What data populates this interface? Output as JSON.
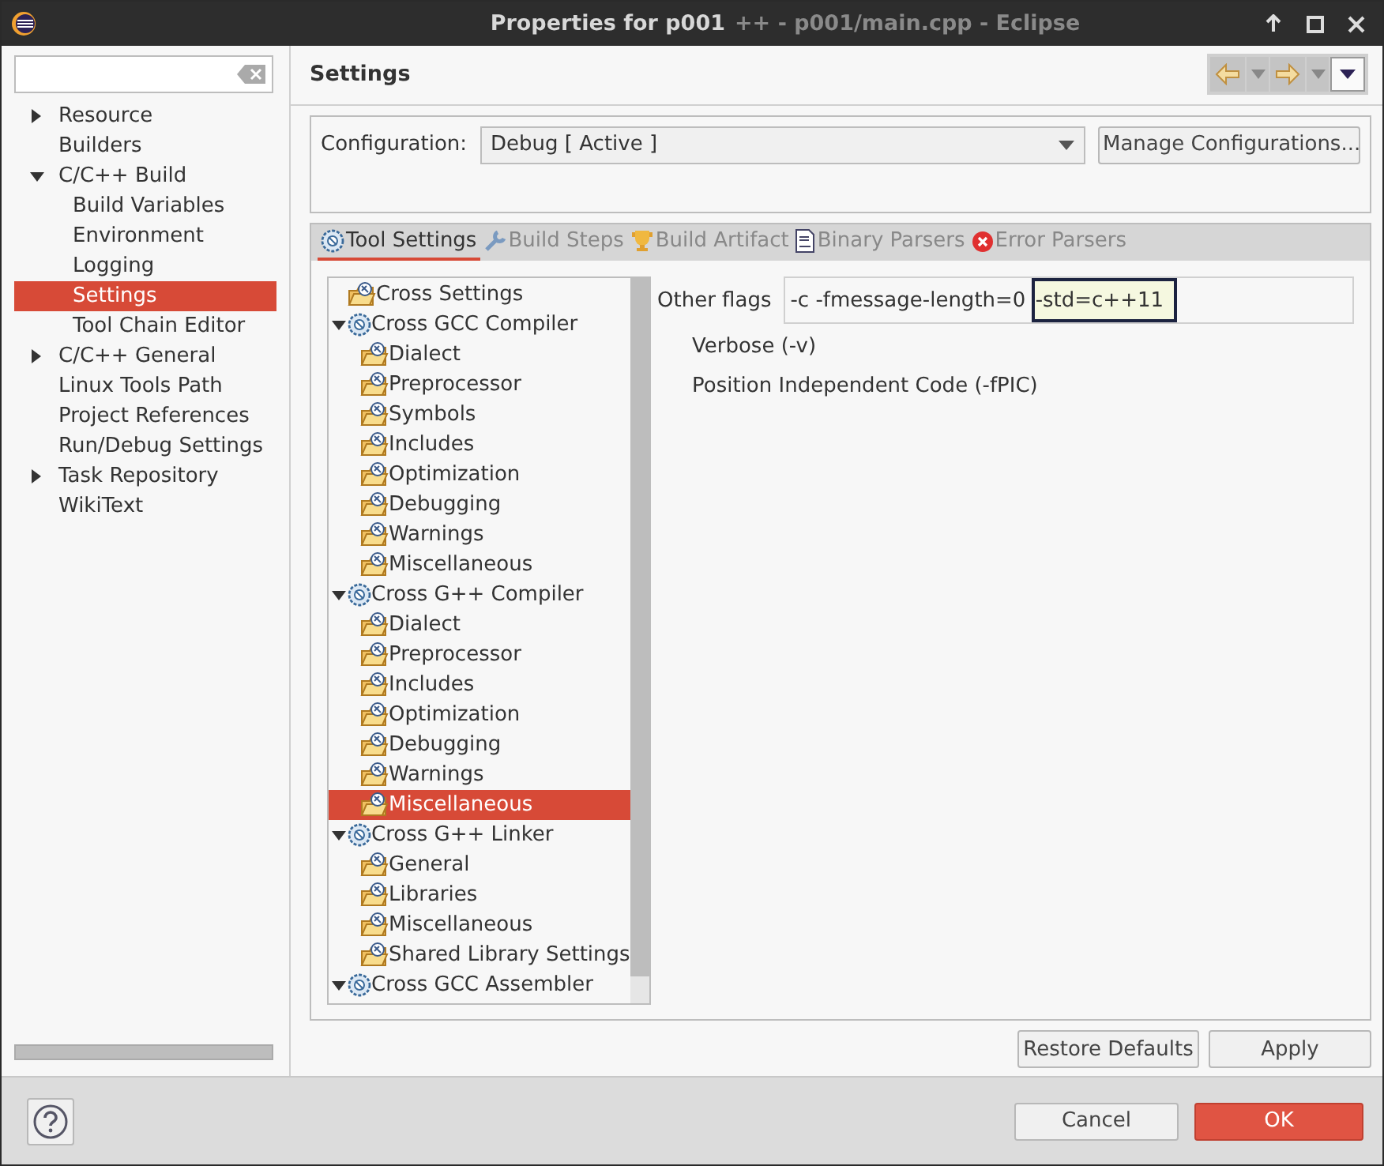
{
  "window": {
    "title": "Properties for p001",
    "behind_title": "++ - p001/main.cpp - Eclipse"
  },
  "sidebar": {
    "items": [
      {
        "label": "Resource",
        "expanded": false,
        "selected": false
      },
      {
        "label": "Builders",
        "selected": false
      },
      {
        "label": "C/C++ Build",
        "expanded": true,
        "selected": false,
        "children": [
          {
            "label": "Build Variables",
            "selected": false
          },
          {
            "label": "Environment",
            "selected": false
          },
          {
            "label": "Logging",
            "selected": false
          },
          {
            "label": "Settings",
            "selected": true
          },
          {
            "label": "Tool Chain Editor",
            "selected": false
          }
        ]
      },
      {
        "label": "C/C++ General",
        "expanded": false,
        "selected": false
      },
      {
        "label": "Linux Tools Path",
        "selected": false
      },
      {
        "label": "Project References",
        "selected": false
      },
      {
        "label": "Run/Debug Settings",
        "selected": false
      },
      {
        "label": "Task Repository",
        "expanded": false,
        "selected": false
      },
      {
        "label": "WikiText",
        "selected": false
      }
    ]
  },
  "page_title": "Settings",
  "configuration": {
    "label": "Configuration:",
    "value": "Debug  [ Active ]",
    "button": "Manage Configurations..."
  },
  "tabs": [
    {
      "label": "Tool Settings",
      "kind": "tool",
      "selected": true
    },
    {
      "label": "Build Steps",
      "kind": "steps",
      "selected": false
    },
    {
      "label": "Build Artifact",
      "kind": "artifact",
      "selected": false
    },
    {
      "label": "Binary Parsers",
      "kind": "binary",
      "selected": false
    },
    {
      "label": "Error Parsers",
      "kind": "error",
      "selected": false
    }
  ],
  "tool_tree": [
    {
      "label": "Cross Settings",
      "kind": "folder",
      "selected": false
    },
    {
      "label": "Cross GCC Compiler",
      "kind": "tool",
      "expanded": true,
      "selected": false,
      "children": [
        {
          "label": "Dialect",
          "kind": "folder",
          "selected": false
        },
        {
          "label": "Preprocessor",
          "kind": "folder",
          "selected": false
        },
        {
          "label": "Symbols",
          "kind": "folder",
          "selected": false
        },
        {
          "label": "Includes",
          "kind": "folder",
          "selected": false
        },
        {
          "label": "Optimization",
          "kind": "folder",
          "selected": false
        },
        {
          "label": "Debugging",
          "kind": "folder",
          "selected": false
        },
        {
          "label": "Warnings",
          "kind": "folder",
          "selected": false
        },
        {
          "label": "Miscellaneous",
          "kind": "folder",
          "selected": false
        }
      ]
    },
    {
      "label": "Cross G++ Compiler",
      "kind": "tool",
      "expanded": true,
      "selected": false,
      "children": [
        {
          "label": "Dialect",
          "kind": "folder",
          "selected": false
        },
        {
          "label": "Preprocessor",
          "kind": "folder",
          "selected": false
        },
        {
          "label": "Includes",
          "kind": "folder",
          "selected": false
        },
        {
          "label": "Optimization",
          "kind": "folder",
          "selected": false
        },
        {
          "label": "Debugging",
          "kind": "folder",
          "selected": false
        },
        {
          "label": "Warnings",
          "kind": "folder",
          "selected": false
        },
        {
          "label": "Miscellaneous",
          "kind": "folder",
          "selected": true
        }
      ]
    },
    {
      "label": "Cross G++ Linker",
      "kind": "tool",
      "expanded": true,
      "selected": false,
      "children": [
        {
          "label": "General",
          "kind": "folder",
          "selected": false
        },
        {
          "label": "Libraries",
          "kind": "folder",
          "selected": false
        },
        {
          "label": "Miscellaneous",
          "kind": "folder",
          "selected": false
        },
        {
          "label": "Shared Library Settings",
          "kind": "folder",
          "selected": false
        }
      ]
    },
    {
      "label": "Cross GCC Assembler",
      "kind": "tool",
      "expanded": true,
      "selected": false
    }
  ],
  "options": {
    "other_flags": {
      "label": "Other flags",
      "value": "-c -fmessage-length=0 ",
      "highlight": "-std=c++11"
    },
    "checks": [
      "Verbose (-v)",
      "Position Independent Code (-fPIC)"
    ]
  },
  "buttons": {
    "restore": "Restore Defaults",
    "apply": "Apply",
    "cancel": "Cancel",
    "ok": "OK"
  }
}
